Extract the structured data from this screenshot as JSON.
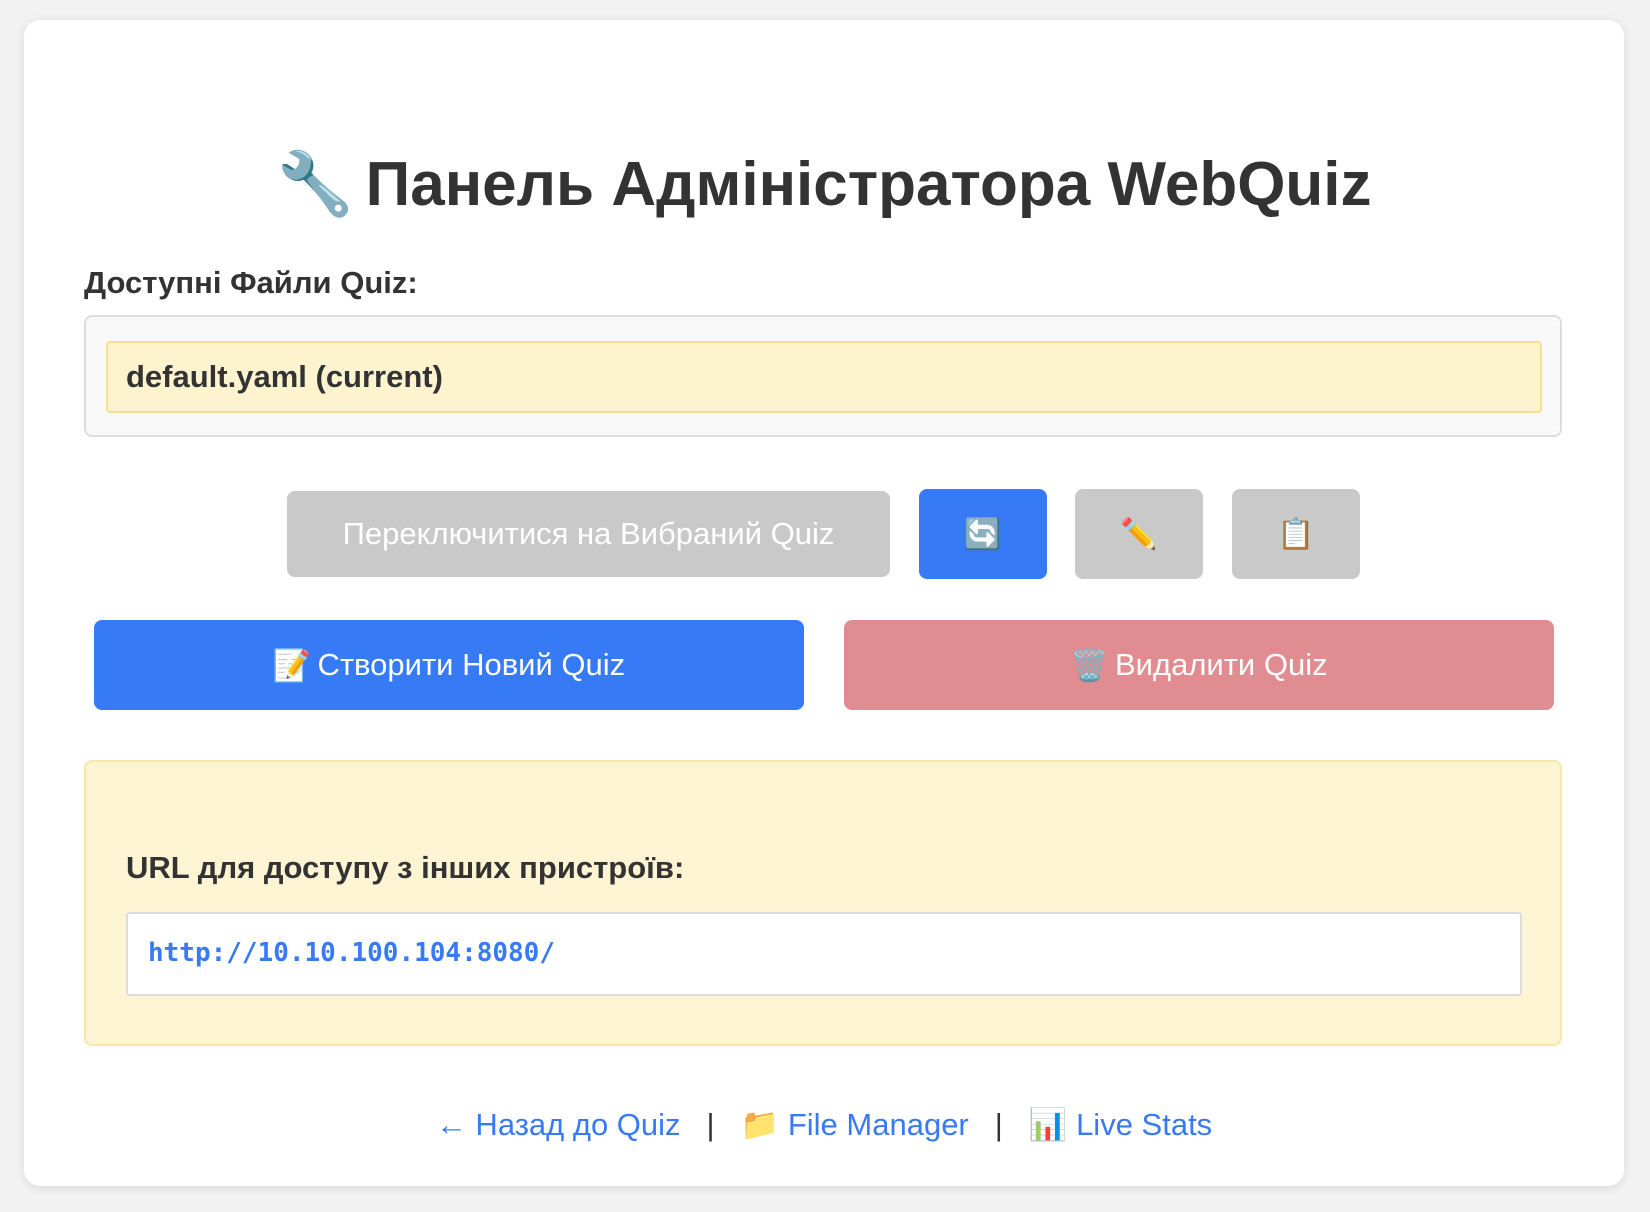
{
  "header": {
    "title_icon": "🔧",
    "title": "Панель Адміністратора WebQuiz"
  },
  "files": {
    "label": "Доступні Файли Quiz:",
    "items": [
      {
        "name": "default.yaml (current)",
        "selected": true
      }
    ]
  },
  "actions": {
    "switch_label": "Переключитися на Вибраний Quiz",
    "refresh_icon": "🔄",
    "edit_icon": "✏️",
    "copy_icon": "📋",
    "create_icon": "📝",
    "create_label": "Створити Новий Quiz",
    "delete_icon": "🗑️",
    "delete_label": "Видалити Quiz"
  },
  "network": {
    "label": "URL для доступу з інших пристроїв:",
    "url": "http://10.10.100.104:8080/"
  },
  "footer": {
    "back_link": "← Назад до Quiz",
    "file_manager_icon": "📁",
    "file_manager_label": "File Manager",
    "live_stats_icon": "📊",
    "live_stats_label": "Live Stats",
    "separator": "|"
  },
  "colors": {
    "primary": "#377af5",
    "danger": "#e18c90",
    "disabled": "#c9c9c9",
    "highlight": "#fdf4cf"
  }
}
